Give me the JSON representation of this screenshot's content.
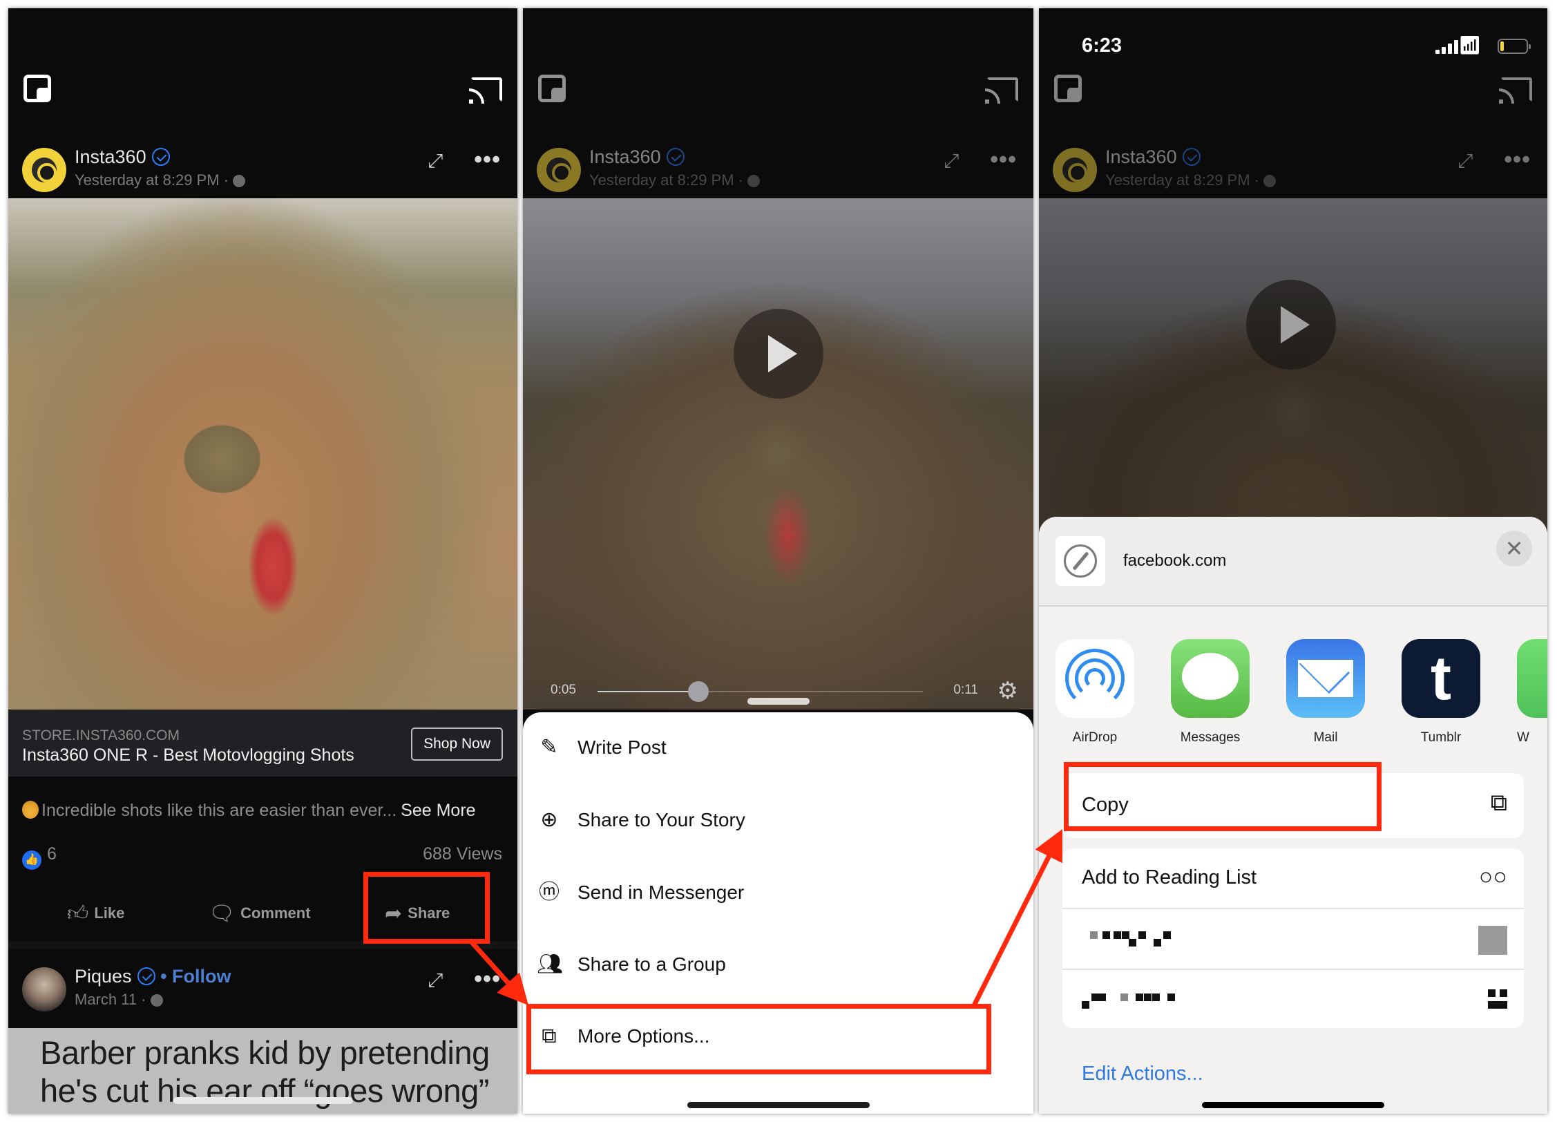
{
  "panels": {
    "feed": {
      "post": {
        "author": "Insta360",
        "verified": true,
        "timestamp": "Yesterday at 8:29 PM ·",
        "ad_domain": "STORE.INSTA360.COM",
        "ad_title": "Insta360 ONE R - Best Motovlogging Shots",
        "cta_label": "Shop Now",
        "caption": "Incredible shots like this are easier than ever...",
        "see_more": "See More",
        "like_count": "6",
        "views": "688 Views",
        "actions": {
          "like": "Like",
          "comment": "Comment",
          "share": "Share"
        }
      },
      "next_post": {
        "author": "Piques",
        "follow_label": "• Follow",
        "timestamp": "March 11 ·",
        "video_text_line1": "Barber pranks kid by pretending",
        "video_text_line2": "he's cut his ear off “goes wrong”"
      },
      "icons": {
        "pip": "picture-in-picture-icon",
        "cast": "cast-icon",
        "expand": "expand-icon",
        "more": "more-horizontal-icon"
      }
    },
    "share_menu": {
      "post_author": "Insta360",
      "timestamp": "Yesterday at 8:29 PM ·",
      "video": {
        "elapsed": "0:05",
        "remaining": "0:11",
        "progress_fraction": 0.31
      },
      "items": [
        {
          "label": "Write Post",
          "icon": "compose-icon"
        },
        {
          "label": "Share to Your Story",
          "icon": "plus-circle-icon"
        },
        {
          "label": "Send in Messenger",
          "icon": "messenger-icon"
        },
        {
          "label": "Share to a Group",
          "icon": "group-icon"
        },
        {
          "label": "More Options...",
          "icon": "external-share-icon"
        }
      ]
    },
    "ios_share_sheet": {
      "status_bar": {
        "time": "6:23",
        "battery_level_fraction": 0.15
      },
      "post_author": "Insta360",
      "timestamp": "Yesterday at 8:29 PM ·",
      "site": "facebook.com",
      "close_label": "✕",
      "apps": [
        {
          "label": "AirDrop"
        },
        {
          "label": "Messages"
        },
        {
          "label": "Mail"
        },
        {
          "label": "Tumblr"
        },
        {
          "label": "W"
        }
      ],
      "copy_label": "Copy",
      "reading_list_label": "Add to Reading List",
      "edit_actions_label": "Edit Actions..."
    }
  },
  "annotations": {
    "color": "#ff2a0e",
    "highlighted": [
      "Share",
      "More Options...",
      "Copy"
    ]
  }
}
